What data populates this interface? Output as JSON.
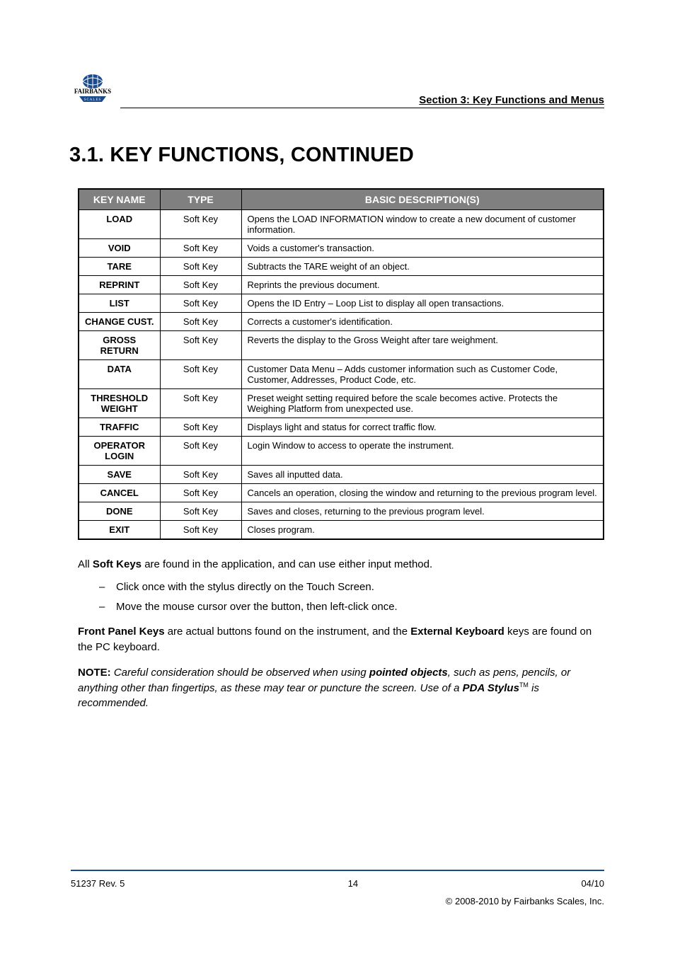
{
  "header": {
    "section_title": "Section 3: Key Functions and Menus"
  },
  "heading": "3.1.  KEY FUNCTIONS, CONTINUED",
  "table": {
    "headers": [
      "KEY NAME",
      "TYPE",
      "BASIC DESCRIPTION(S)"
    ],
    "rows": [
      [
        "LOAD",
        "Soft Key",
        "Opens the LOAD INFORMATION window to create a new document of customer information."
      ],
      [
        "VOID",
        "Soft Key",
        "Voids a customer's transaction."
      ],
      [
        "TARE",
        "Soft Key",
        "Subtracts the TARE weight of an object."
      ],
      [
        "REPRINT",
        "Soft Key",
        "Reprints the previous document."
      ],
      [
        "LIST",
        "Soft Key",
        "Opens the ID Entry – Loop List to display all open transactions."
      ],
      [
        "CHANGE CUST.",
        "Soft Key",
        "Corrects a customer's identification."
      ],
      [
        "GROSS RETURN",
        "Soft Key",
        "Reverts the display to the Gross Weight after tare weighment."
      ],
      [
        "DATA",
        "Soft Key",
        "Customer Data Menu  – Adds customer information such as Customer Code, Customer, Addresses, Product Code, etc."
      ],
      [
        "THRESHOLD WEIGHT",
        "Soft Key",
        "Preset weight setting required before the scale becomes active.   Protects the Weighing Platform from unexpected use."
      ],
      [
        "TRAFFIC",
        "Soft Key",
        "Displays light and status for correct traffic flow."
      ],
      [
        "OPERATOR LOGIN",
        "Soft Key",
        "Login Window to access to operate the instrument."
      ],
      [
        "SAVE",
        "Soft Key",
        "Saves all inputted data."
      ],
      [
        "CANCEL",
        "Soft Key",
        "Cancels an operation, closing the window and returning to the previous program level."
      ],
      [
        "DONE",
        "Soft Key",
        "Saves and closes, returning to the previous program level."
      ],
      [
        "EXIT",
        "Soft Key",
        "Closes program."
      ]
    ]
  },
  "body": {
    "para1_prefix": "All ",
    "para1_strong": "Soft Keys",
    "para1_suffix": " are found in the application, and can use either input method.",
    "bullets": [
      "Click once with the stylus directly on the Touch Screen.",
      "Move the mouse cursor over the button, then left-click once."
    ],
    "para2_a": "Front Panel Keys",
    "para2_b": " are actual buttons found on the instrument, and the ",
    "para2_c": "External Keyboard",
    "para2_d": " keys are found on the PC keyboard.",
    "note_label": "NOTE:",
    "note_body_a": "  ",
    "note_body_b": "Careful consideration should be observed when using",
    "note_body_c": " pointed objects",
    "note_body_d": ", such as pens, pencils, or anything other than fingertips, as these may tear or puncture the screen.  Use of a ",
    "note_body_e": "PDA Stylus",
    "note_tm": "TM",
    "note_body_f": " is recommended."
  },
  "footer": {
    "left_line1": "51237 Rev. 5",
    "center_line1": "14",
    "right_line1": "04/10",
    "left_line2": "",
    "center_line2": "",
    "right_line2": "© 2008-2010 by Fairbanks Scales, Inc."
  }
}
